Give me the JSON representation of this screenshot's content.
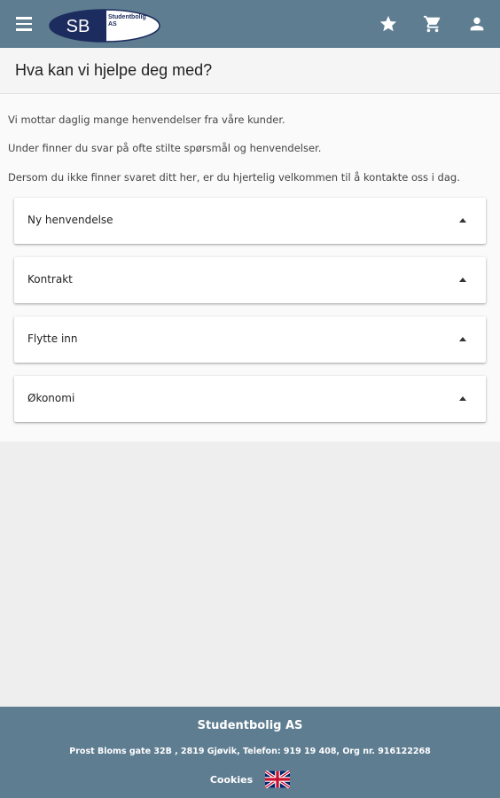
{
  "header": {
    "logo_initials": "SB",
    "logo_name_line1": "Studentbolig",
    "logo_name_line2": "AS",
    "icons": [
      "menu-icon",
      "star-icon",
      "cart-icon",
      "user-icon"
    ]
  },
  "page": {
    "title": "Hva kan vi hjelpe deg med?"
  },
  "intro": {
    "line1": "Vi mottar daglig mange henvendelser fra våre kunder.",
    "line2": "Under finner du svar på ofte stilte spørsmål og henvendelser.",
    "line3": "Dersom du ikke finner svaret ditt her, er du hjertelig velkommen til å kontakte oss i dag."
  },
  "faq": [
    {
      "label": "Ny henvendelse",
      "icon": "caret-up-icon"
    },
    {
      "label": "Kontrakt",
      "icon": "caret-up-icon"
    },
    {
      "label": "Flytte inn",
      "icon": "caret-up-icon"
    },
    {
      "label": "Økonomi",
      "icon": "caret-up-icon"
    }
  ],
  "footer": {
    "company": "Studentbolig AS",
    "address": "Prost Bloms gate 32B , 2819 Gjøvik, Telefon: 919 19 408, Org nr. 916122268",
    "cookies": "Cookies",
    "language_flag": "uk-flag-icon"
  },
  "colors": {
    "header_bg": "#5e7d91",
    "footer_bg": "#5e7d91",
    "page_bg": "#eeeeee",
    "logo_navy": "#1d2c5e"
  }
}
